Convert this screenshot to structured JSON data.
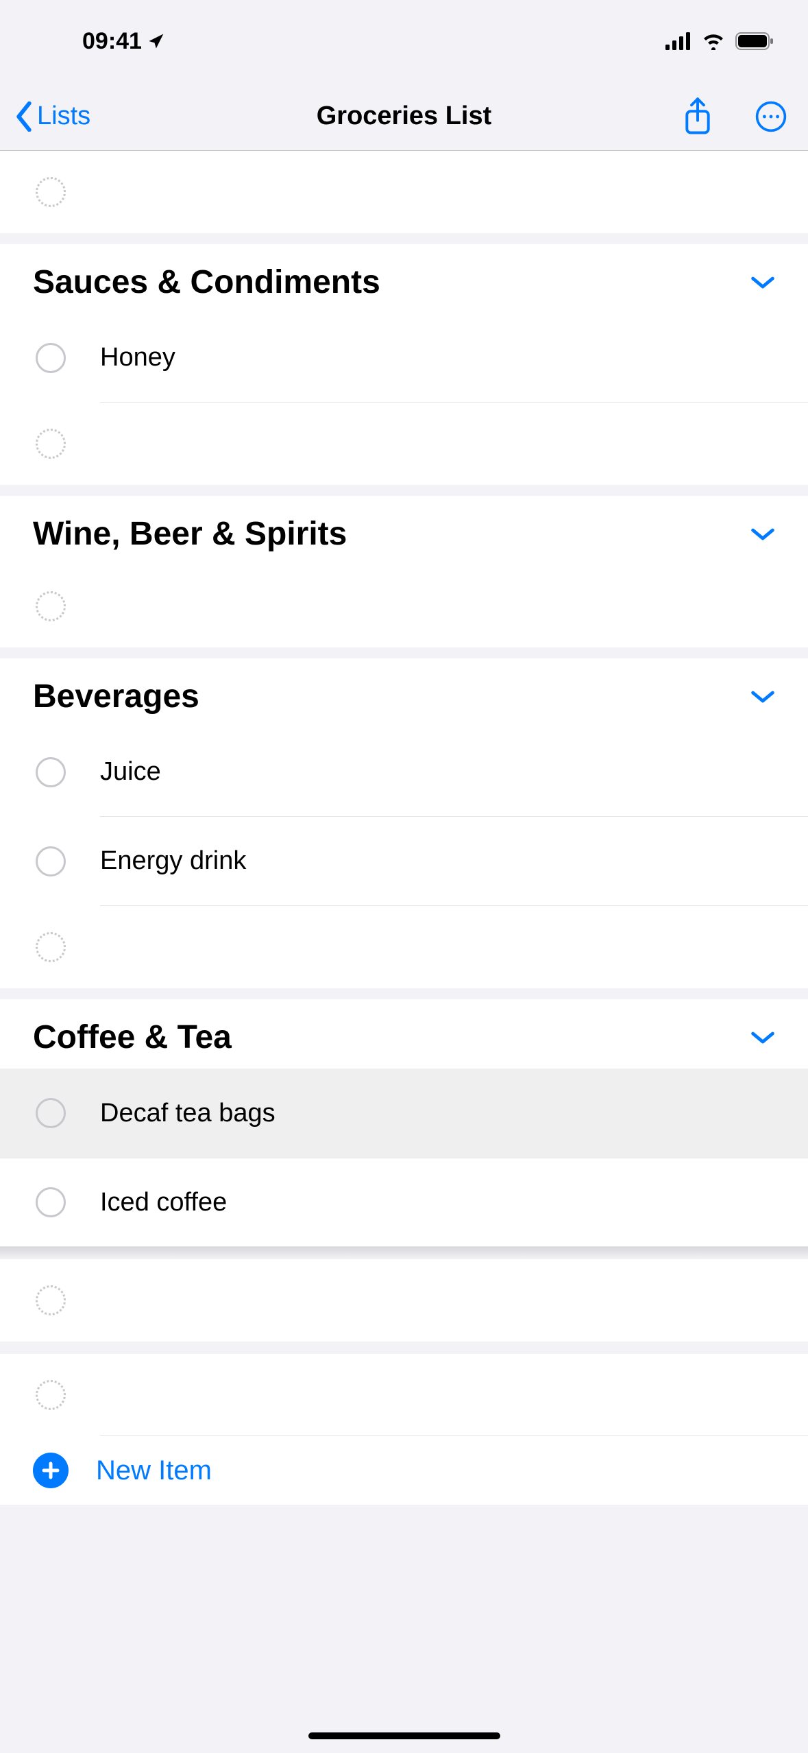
{
  "status_bar": {
    "time": "09:41"
  },
  "nav": {
    "back_label": "Lists",
    "title": "Groceries List"
  },
  "sections": [
    {
      "title": "Sauces & Condiments",
      "items": [
        "Honey"
      ]
    },
    {
      "title": "Wine, Beer & Spirits",
      "items": []
    },
    {
      "title": "Beverages",
      "items": [
        "Juice",
        "Energy drink"
      ]
    },
    {
      "title": "Coffee & Tea",
      "items": [
        "Decaf tea bags",
        "Iced coffee"
      ]
    }
  ],
  "new_item_label": "New Item"
}
